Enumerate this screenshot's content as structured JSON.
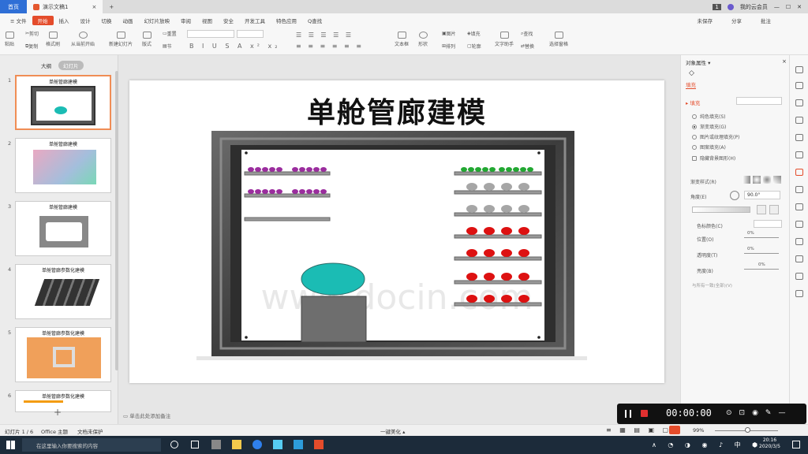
{
  "tabs": {
    "home": "首页",
    "doc": "演示文稿1",
    "add": "+",
    "account": "我的云会员",
    "user_num": "1"
  },
  "ribbon": {
    "items": [
      "≡ 文件",
      "开始",
      "插入",
      "设计",
      "切换",
      "动画",
      "幻灯片放映",
      "审阅",
      "视图",
      "安全",
      "开发工具",
      "特色应用",
      "Q查找"
    ],
    "active_index": 1,
    "right": [
      "未保存",
      "分享",
      "批注"
    ]
  },
  "toolbar": {
    "paste": "粘贴",
    "cut": "剪切",
    "copy": "复制",
    "format_painter": "格式刷",
    "from_current": "从当前开始",
    "new_slide": "新建幻灯片",
    "layout": "版式",
    "section": "节",
    "reset": "重置",
    "textbox": "文本框",
    "shape": "形状",
    "arrange": "排列",
    "picture": "图片",
    "fill": "填充",
    "outline": "轮廓",
    "find": "查找",
    "replace": "替换",
    "text_tool": "文字助手",
    "select_pane": "选择窗格"
  },
  "leftpane": {
    "tab_outline": "大纲",
    "tab_slides": "幻灯片",
    "add": "+",
    "slides": [
      {
        "num": "1",
        "title": "单舱管廊建模"
      },
      {
        "num": "2",
        "title": "单舱管廊建模"
      },
      {
        "num": "3",
        "title": "单舱管廊建模"
      },
      {
        "num": "4",
        "title": "单舱管廊参数化建模"
      },
      {
        "num": "5",
        "title": "单舱管廊参数化建模"
      },
      {
        "num": "6",
        "title": "单舱管廊参数化建模"
      }
    ]
  },
  "slide": {
    "title": "单舱管廊建模",
    "watermark": "www.docin.com"
  },
  "notes": {
    "placeholder": "单击此处添加备注"
  },
  "rightpane": {
    "title": "对象属性 ▾",
    "section": "填充",
    "fill_label": "▸ 填充",
    "options": [
      "纯色填充(S)",
      "渐变填充(G)",
      "图片或纹理填充(P)",
      "图案填充(A)",
      "隐藏背景图形(H)"
    ],
    "gradient_style": "渐变样式(R)",
    "angle": "角度(E)",
    "angle_value": "90.0°",
    "stop_color": "色标颜色(C)",
    "position": "位置(O)",
    "transparency": "透明度(T)",
    "brightness": "亮度(B)",
    "pct": "0%",
    "apply_all": "与所有一致(全部)(V)"
  },
  "status": {
    "slide": "幻灯片 1 / 6",
    "theme": "Office 主题",
    "protect": "文档未保护",
    "beautify": "一键美化 ▴",
    "zoom": "99%"
  },
  "recorder": {
    "time": "00:00:00"
  },
  "taskbar": {
    "search": "在这里输入你要搜索的内容",
    "time": "20:16",
    "date": "2020/3/5"
  },
  "colors": {
    "accent": "#e44c2b",
    "purple": "#9b2d9e",
    "green": "#22a832",
    "red": "#dd1111",
    "gray": "#a6a6a6",
    "teal": "#1bbcb4"
  }
}
